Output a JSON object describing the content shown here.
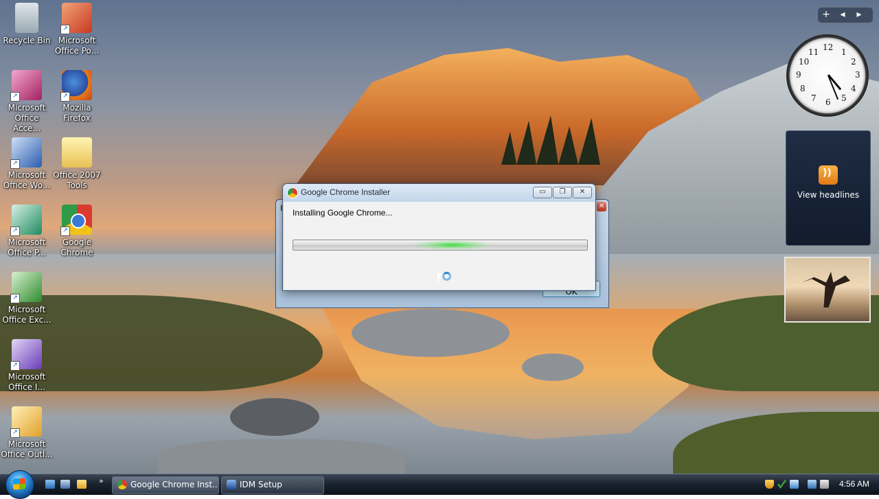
{
  "desktop": {
    "icons": [
      {
        "label": "Recycle Bin"
      },
      {
        "label": "Microsoft Office Po..."
      },
      {
        "label": "Microsoft Office Acce..."
      },
      {
        "label": "Mozilla Firefox"
      },
      {
        "label": "Microsoft Office Wo..."
      },
      {
        "label": "Office 2007 Tools"
      },
      {
        "label": "Microsoft Office P..."
      },
      {
        "label": "Google Chrome"
      },
      {
        "label": "Microsoft Office Exc..."
      },
      {
        "label": "Microsoft Office I..."
      },
      {
        "label": "Microsoft Office Outl..."
      }
    ]
  },
  "sidebar": {
    "controls": [
      "+",
      "◂",
      "▸"
    ],
    "clock_numbers": [
      "12",
      "1",
      "2",
      "3",
      "4",
      "5",
      "6",
      "7",
      "8",
      "9",
      "10",
      "11"
    ],
    "feed_label": "View headlines"
  },
  "back_dialog": {
    "title_letter": "I",
    "close_glyph": "✕",
    "ok_label": "OK"
  },
  "installer": {
    "title": "Google Chrome Installer",
    "status_text": "Installing Google Chrome...",
    "min_glyph": "▭",
    "max_glyph": "❐",
    "close_glyph": "✕"
  },
  "taskbar": {
    "tasks": [
      {
        "label": "Google Chrome Inst..."
      },
      {
        "label": "IDM Setup"
      }
    ],
    "overflow_glyph": "»",
    "time": "4:56 AM"
  },
  "colors": {
    "progress_glow": "#3cdc3c",
    "taskbar": "#1b2430",
    "dialog_frame": "#c4d7ec"
  }
}
